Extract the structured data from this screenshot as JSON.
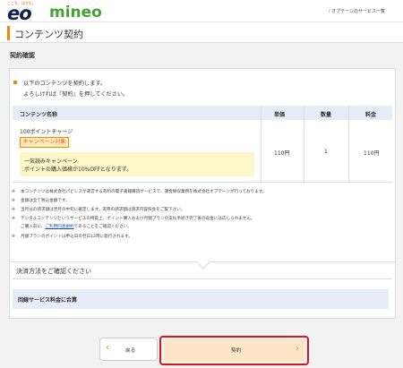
{
  "header": {
    "tagline": "ここち、はずむ。",
    "brand_eo": "eo",
    "brand_mineo": "mineo",
    "service_list_link": "› オプテージのサービス一覧"
  },
  "page": {
    "title": "コンテンツ契約"
  },
  "confirm": {
    "heading": "契約確認",
    "intro_line1": "以下のコンテンツを契約します。",
    "intro_line2": "よろしければ『契約』を押してください。"
  },
  "table": {
    "headers": {
      "name": "コンテンツ名称",
      "unit_price": "単価",
      "quantity": "数量",
      "amount": "料金"
    },
    "row": {
      "name": "100ポイントチャージ",
      "badge": "キャンペーン対象",
      "campaign_title": "一気読みキャンペーン",
      "campaign_desc": "ポイントの購入価格が10%OFFとなります。",
      "unit_price": "110円",
      "quantity": "1",
      "amount": "110円"
    }
  },
  "notes": {
    "mark": "※",
    "n1": "本コンテンツは株式会社パピレスが運営する有料の電子書籍購読サービスで、課金徴収業務を株式会社オプテージが行っております。",
    "n2": "金額は全て税込金額です。",
    "n3": "当月分の請求額は翌月の中旬に確定します。実際の請求額は請求内容照会をご覧下さい。",
    "n4": "デジタルコンテンツというサービスの特質上、ポイント購入および月額プランの支払手続き完了後の返金には応じられません。",
    "n4b_pre": "ご購入前に、",
    "n4b_link": "ご利用同意規約",
    "n4b_post": "であることをご確認ください。",
    "n5": "月額プランのポイントは申込日の翌日12時に発行されます。"
  },
  "payment": {
    "title": "決済方法をご確認ください",
    "method": "回線サービス料金に合算"
  },
  "buttons": {
    "back_label": "戻る",
    "back_icon": "‹",
    "contract_label": "契約",
    "contract_icon": "›"
  },
  "colors": {
    "accent_orange": "#f08a00",
    "eo_navy": "#141f4b",
    "mineo_green": "#43a332",
    "highlight_red": "#d8161d"
  }
}
